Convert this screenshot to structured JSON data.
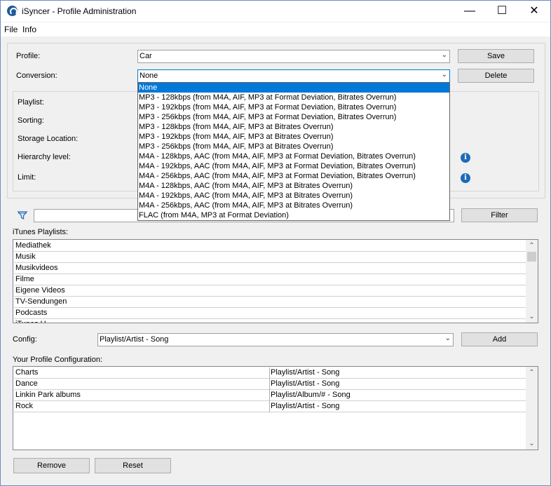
{
  "window": {
    "title": "iSyncer - Profile Administration",
    "controls": {
      "minimize": "—",
      "maximize": "☐",
      "close": "✕"
    }
  },
  "menu": [
    "File",
    "Info"
  ],
  "profile": {
    "profile_label": "Profile:",
    "profile_value": "Car",
    "conversion_label": "Conversion:",
    "conversion_value": "None",
    "save_label": "Save",
    "delete_label": "Delete"
  },
  "details": {
    "playlist_label": "Playlist:",
    "sorting_label": "Sorting:",
    "storage_label": "Storage Location:",
    "hierarchy_label": "Hierarchy level:",
    "limit_label": "Limit:"
  },
  "conversion_options": [
    "None",
    "MP3 - 128kbps (from M4A, AIF, MP3 at Format Deviation, Bitrates Overrun)",
    "MP3 - 192kbps (from M4A, AIF, MP3 at Format Deviation, Bitrates Overrun)",
    "MP3 - 256kbps (from M4A, AIF, MP3 at Format Deviation, Bitrates Overrun)",
    "MP3 - 128kbps (from M4A, AIF, MP3 at Bitrates Overrun)",
    "MP3 - 192kbps (from M4A, AIF, MP3 at Bitrates Overrun)",
    "MP3 - 256kbps (from M4A, AIF, MP3 at Bitrates Overrun)",
    "M4A - 128kbps, AAC (from M4A, AIF, MP3 at Format Deviation, Bitrates Overrun)",
    "M4A - 192kbps, AAC (from M4A, AIF, MP3 at Format Deviation, Bitrates Overrun)",
    "M4A - 256kbps, AAC (from M4A, AIF, MP3 at Format Deviation, Bitrates Overrun)",
    "M4A - 128kbps, AAC (from M4A, AIF, MP3 at Bitrates Overrun)",
    "M4A - 192kbps, AAC (from M4A, AIF, MP3 at Bitrates Overrun)",
    "M4A - 256kbps, AAC (from M4A, AIF, MP3 at Bitrates Overrun)",
    "FLAC (from M4A, MP3 at Format Deviation)"
  ],
  "playlists": {
    "filter_value": "",
    "filter_label": "Filter",
    "header": "iTunes Playlists:",
    "items": [
      "Mediathek",
      "Musik",
      "Musikvideos",
      "Filme",
      "Eigene Videos",
      "TV-Sendungen",
      "Podcasts",
      "iTunes U"
    ]
  },
  "config": {
    "label": "Config:",
    "value": "Playlist/Artist - Song",
    "add_label": "Add"
  },
  "profile_config": {
    "header": "Your Profile Configuration:",
    "rows": [
      {
        "name": "Charts",
        "format": "Playlist/Artist - Song"
      },
      {
        "name": "Dance",
        "format": "Playlist/Artist - Song"
      },
      {
        "name": "Linkin Park albums",
        "format": "Playlist/Album/# - Song"
      },
      {
        "name": "Rock",
        "format": "Playlist/Artist - Song"
      }
    ],
    "remove_label": "Remove",
    "reset_label": "Reset"
  },
  "icons": {
    "info": "i",
    "filter": "filter-funnel-icon",
    "accent": "#0078d7"
  }
}
